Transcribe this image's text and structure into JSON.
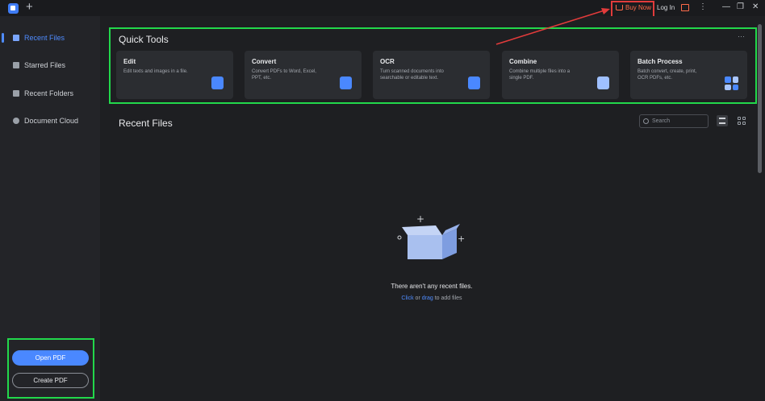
{
  "titlebar": {
    "new_tab": "+",
    "buy_now": "Buy Now",
    "login": "Log In",
    "more": "⋮",
    "minimize": "—",
    "restore": "❐",
    "close": "✕"
  },
  "sidebar": {
    "items": [
      {
        "label": "Recent Files",
        "icon": "recent-files-icon"
      },
      {
        "label": "Starred Files",
        "icon": "star-icon"
      },
      {
        "label": "Recent Folders",
        "icon": "folder-icon"
      },
      {
        "label": "Document Cloud",
        "icon": "cloud-icon"
      }
    ],
    "open_pdf": "Open PDF",
    "create_pdf": "Create PDF"
  },
  "quick_tools": {
    "title": "Quick Tools",
    "more": "···",
    "cards": [
      {
        "title": "Edit",
        "desc": "Edit texts and images in a file."
      },
      {
        "title": "Convert",
        "desc": "Convert PDFs to Word, Excel, PPT, etc."
      },
      {
        "title": "OCR",
        "desc": "Turn scanned documents into searchable or editable text."
      },
      {
        "title": "Combine",
        "desc": "Combine multiple files into a single PDF."
      },
      {
        "title": "Batch Process",
        "desc": "Batch convert, create, print, OCR PDFs, etc."
      }
    ]
  },
  "recent": {
    "title": "Recent Files",
    "search_placeholder": "Search",
    "empty_text": "There aren't any recent files.",
    "click": "Click",
    "or": "or",
    "drag": "drag",
    "to_add": "to add files"
  },
  "colors": {
    "accent": "#4a88ff",
    "highlight_green": "#22d84b",
    "annotation_red": "#e23b3b"
  }
}
